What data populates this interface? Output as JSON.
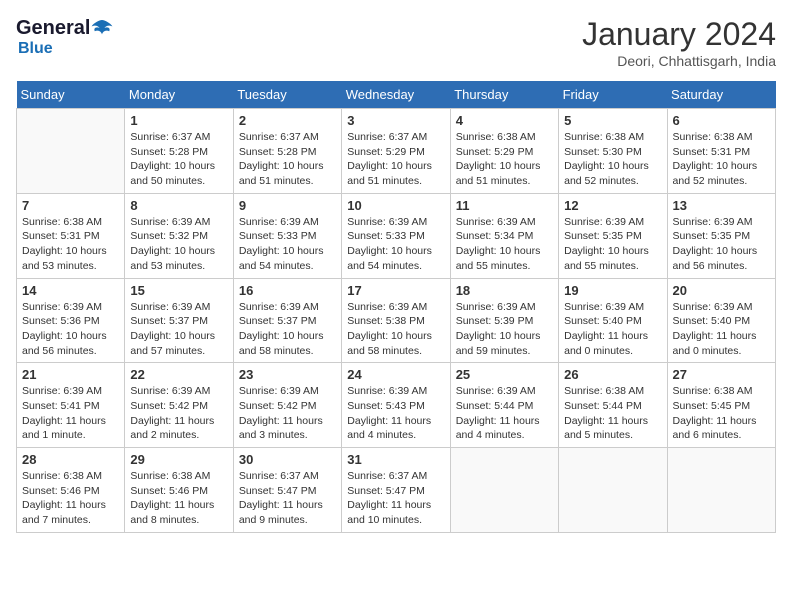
{
  "header": {
    "logo_line1": "General",
    "logo_line2": "Blue",
    "month": "January 2024",
    "location": "Deori, Chhattisgarh, India"
  },
  "columns": [
    "Sunday",
    "Monday",
    "Tuesday",
    "Wednesday",
    "Thursday",
    "Friday",
    "Saturday"
  ],
  "weeks": [
    [
      {
        "day": "",
        "sunrise": "",
        "sunset": "",
        "daylight": ""
      },
      {
        "day": "1",
        "sunrise": "Sunrise: 6:37 AM",
        "sunset": "Sunset: 5:28 PM",
        "daylight": "Daylight: 10 hours and 50 minutes."
      },
      {
        "day": "2",
        "sunrise": "Sunrise: 6:37 AM",
        "sunset": "Sunset: 5:28 PM",
        "daylight": "Daylight: 10 hours and 51 minutes."
      },
      {
        "day": "3",
        "sunrise": "Sunrise: 6:37 AM",
        "sunset": "Sunset: 5:29 PM",
        "daylight": "Daylight: 10 hours and 51 minutes."
      },
      {
        "day": "4",
        "sunrise": "Sunrise: 6:38 AM",
        "sunset": "Sunset: 5:29 PM",
        "daylight": "Daylight: 10 hours and 51 minutes."
      },
      {
        "day": "5",
        "sunrise": "Sunrise: 6:38 AM",
        "sunset": "Sunset: 5:30 PM",
        "daylight": "Daylight: 10 hours and 52 minutes."
      },
      {
        "day": "6",
        "sunrise": "Sunrise: 6:38 AM",
        "sunset": "Sunset: 5:31 PM",
        "daylight": "Daylight: 10 hours and 52 minutes."
      }
    ],
    [
      {
        "day": "7",
        "sunrise": "Sunrise: 6:38 AM",
        "sunset": "Sunset: 5:31 PM",
        "daylight": "Daylight: 10 hours and 53 minutes."
      },
      {
        "day": "8",
        "sunrise": "Sunrise: 6:39 AM",
        "sunset": "Sunset: 5:32 PM",
        "daylight": "Daylight: 10 hours and 53 minutes."
      },
      {
        "day": "9",
        "sunrise": "Sunrise: 6:39 AM",
        "sunset": "Sunset: 5:33 PM",
        "daylight": "Daylight: 10 hours and 54 minutes."
      },
      {
        "day": "10",
        "sunrise": "Sunrise: 6:39 AM",
        "sunset": "Sunset: 5:33 PM",
        "daylight": "Daylight: 10 hours and 54 minutes."
      },
      {
        "day": "11",
        "sunrise": "Sunrise: 6:39 AM",
        "sunset": "Sunset: 5:34 PM",
        "daylight": "Daylight: 10 hours and 55 minutes."
      },
      {
        "day": "12",
        "sunrise": "Sunrise: 6:39 AM",
        "sunset": "Sunset: 5:35 PM",
        "daylight": "Daylight: 10 hours and 55 minutes."
      },
      {
        "day": "13",
        "sunrise": "Sunrise: 6:39 AM",
        "sunset": "Sunset: 5:35 PM",
        "daylight": "Daylight: 10 hours and 56 minutes."
      }
    ],
    [
      {
        "day": "14",
        "sunrise": "Sunrise: 6:39 AM",
        "sunset": "Sunset: 5:36 PM",
        "daylight": "Daylight: 10 hours and 56 minutes."
      },
      {
        "day": "15",
        "sunrise": "Sunrise: 6:39 AM",
        "sunset": "Sunset: 5:37 PM",
        "daylight": "Daylight: 10 hours and 57 minutes."
      },
      {
        "day": "16",
        "sunrise": "Sunrise: 6:39 AM",
        "sunset": "Sunset: 5:37 PM",
        "daylight": "Daylight: 10 hours and 58 minutes."
      },
      {
        "day": "17",
        "sunrise": "Sunrise: 6:39 AM",
        "sunset": "Sunset: 5:38 PM",
        "daylight": "Daylight: 10 hours and 58 minutes."
      },
      {
        "day": "18",
        "sunrise": "Sunrise: 6:39 AM",
        "sunset": "Sunset: 5:39 PM",
        "daylight": "Daylight: 10 hours and 59 minutes."
      },
      {
        "day": "19",
        "sunrise": "Sunrise: 6:39 AM",
        "sunset": "Sunset: 5:40 PM",
        "daylight": "Daylight: 11 hours and 0 minutes."
      },
      {
        "day": "20",
        "sunrise": "Sunrise: 6:39 AM",
        "sunset": "Sunset: 5:40 PM",
        "daylight": "Daylight: 11 hours and 0 minutes."
      }
    ],
    [
      {
        "day": "21",
        "sunrise": "Sunrise: 6:39 AM",
        "sunset": "Sunset: 5:41 PM",
        "daylight": "Daylight: 11 hours and 1 minute."
      },
      {
        "day": "22",
        "sunrise": "Sunrise: 6:39 AM",
        "sunset": "Sunset: 5:42 PM",
        "daylight": "Daylight: 11 hours and 2 minutes."
      },
      {
        "day": "23",
        "sunrise": "Sunrise: 6:39 AM",
        "sunset": "Sunset: 5:42 PM",
        "daylight": "Daylight: 11 hours and 3 minutes."
      },
      {
        "day": "24",
        "sunrise": "Sunrise: 6:39 AM",
        "sunset": "Sunset: 5:43 PM",
        "daylight": "Daylight: 11 hours and 4 minutes."
      },
      {
        "day": "25",
        "sunrise": "Sunrise: 6:39 AM",
        "sunset": "Sunset: 5:44 PM",
        "daylight": "Daylight: 11 hours and 4 minutes."
      },
      {
        "day": "26",
        "sunrise": "Sunrise: 6:38 AM",
        "sunset": "Sunset: 5:44 PM",
        "daylight": "Daylight: 11 hours and 5 minutes."
      },
      {
        "day": "27",
        "sunrise": "Sunrise: 6:38 AM",
        "sunset": "Sunset: 5:45 PM",
        "daylight": "Daylight: 11 hours and 6 minutes."
      }
    ],
    [
      {
        "day": "28",
        "sunrise": "Sunrise: 6:38 AM",
        "sunset": "Sunset: 5:46 PM",
        "daylight": "Daylight: 11 hours and 7 minutes."
      },
      {
        "day": "29",
        "sunrise": "Sunrise: 6:38 AM",
        "sunset": "Sunset: 5:46 PM",
        "daylight": "Daylight: 11 hours and 8 minutes."
      },
      {
        "day": "30",
        "sunrise": "Sunrise: 6:37 AM",
        "sunset": "Sunset: 5:47 PM",
        "daylight": "Daylight: 11 hours and 9 minutes."
      },
      {
        "day": "31",
        "sunrise": "Sunrise: 6:37 AM",
        "sunset": "Sunset: 5:47 PM",
        "daylight": "Daylight: 11 hours and 10 minutes."
      },
      {
        "day": "",
        "sunrise": "",
        "sunset": "",
        "daylight": ""
      },
      {
        "day": "",
        "sunrise": "",
        "sunset": "",
        "daylight": ""
      },
      {
        "day": "",
        "sunrise": "",
        "sunset": "",
        "daylight": ""
      }
    ]
  ]
}
